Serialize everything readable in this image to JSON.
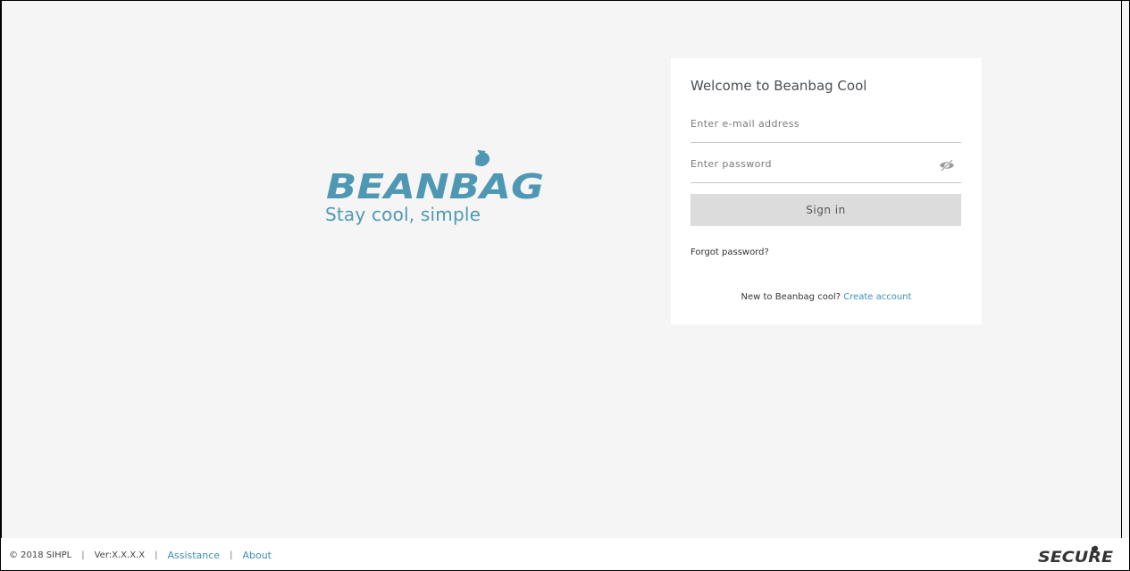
{
  "brand": {
    "logo_text": "BEANBAG",
    "tagline": "Stay cool, simple",
    "color": "#4e98b4"
  },
  "login": {
    "title": "Welcome to Beanbag Cool",
    "email_placeholder": "Enter e-mail address",
    "email_value": "",
    "password_placeholder": "Enter password",
    "password_value": "",
    "password_toggle_icon": "eye-slash-icon",
    "signin_label": "Sign in",
    "forgot_label": "Forgot password?",
    "new_user_prompt": "New to Beanbag cool?",
    "create_account_label": "Create account",
    "link_color": "#3c8fb8"
  },
  "footer": {
    "copyright": "© 2018 SIHPL",
    "version": "Ver:X.X.X.X",
    "assistance_label": "Assistance",
    "about_label": "About",
    "separator": "|",
    "secure_logo_text": "SECURE"
  }
}
